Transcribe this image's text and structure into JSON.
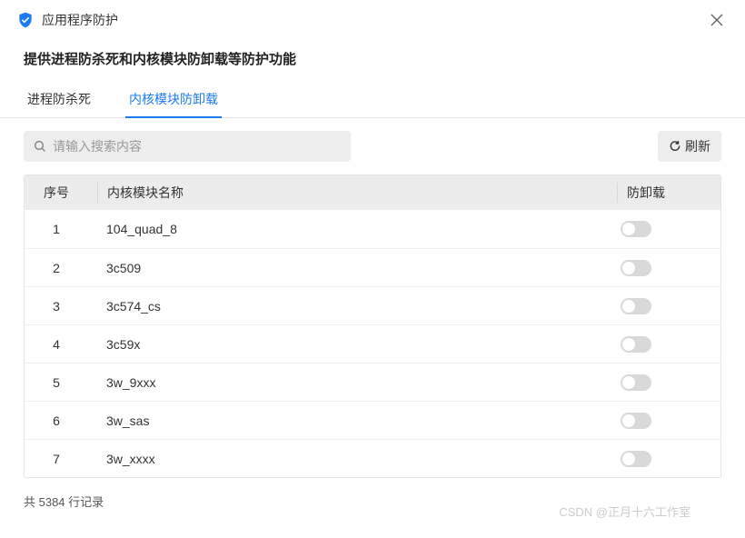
{
  "window": {
    "title": "应用程序防护",
    "subtitle": "提供进程防杀死和内核模块防卸载等防护功能"
  },
  "tabs": [
    {
      "label": "进程防杀死",
      "active": false
    },
    {
      "label": "内核模块防卸载",
      "active": true
    }
  ],
  "search": {
    "placeholder": "请输入搜索内容",
    "value": ""
  },
  "toolbar": {
    "refresh_label": "刷新"
  },
  "table": {
    "columns": {
      "seq": "序号",
      "name": "内核模块名称",
      "toggle": "防卸载"
    },
    "rows": [
      {
        "seq": 1,
        "name": "104_quad_8",
        "enabled": false
      },
      {
        "seq": 2,
        "name": "3c509",
        "enabled": false
      },
      {
        "seq": 3,
        "name": "3c574_cs",
        "enabled": false
      },
      {
        "seq": 4,
        "name": "3c59x",
        "enabled": false
      },
      {
        "seq": 5,
        "name": "3w_9xxx",
        "enabled": false
      },
      {
        "seq": 6,
        "name": "3w_sas",
        "enabled": false
      },
      {
        "seq": 7,
        "name": "3w_xxxx",
        "enabled": false
      }
    ]
  },
  "footer": {
    "total_text": "共 5384 行记录",
    "total_count": 5384
  },
  "watermark": "CSDN @正月十六工作室"
}
